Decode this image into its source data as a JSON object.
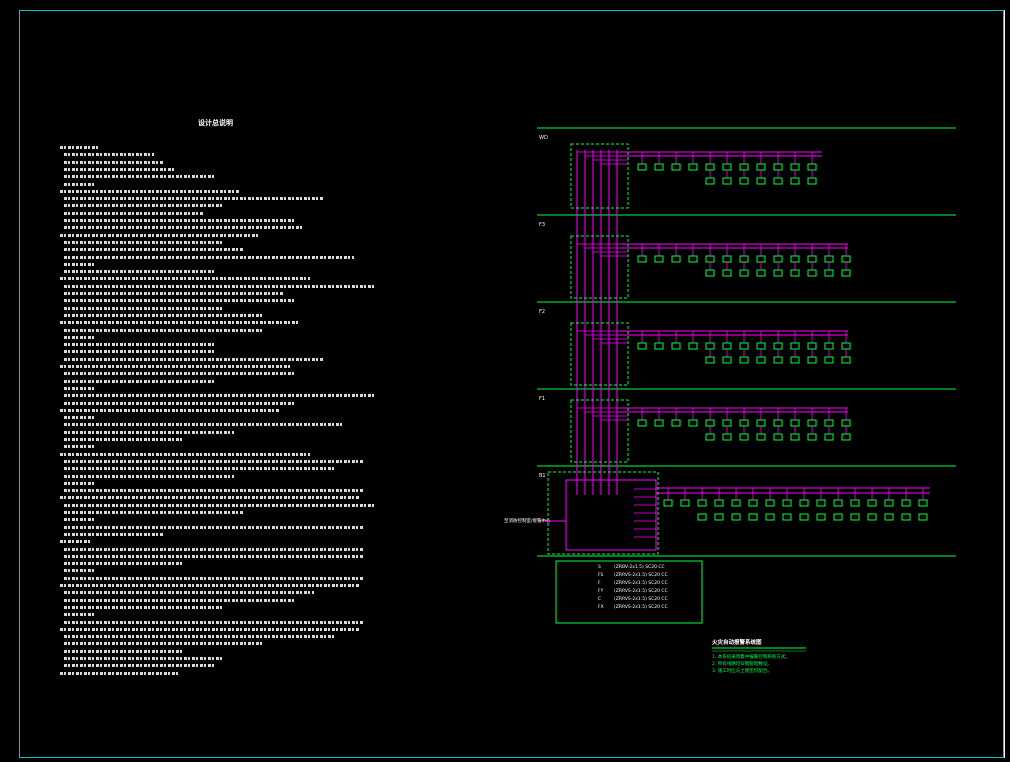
{
  "drawing": {
    "notes_title": "设计总说明",
    "diagram_title": "火灾自动报警系统图",
    "floors": [
      "WD",
      "F3",
      "F2",
      "F1",
      "B1"
    ],
    "legend": {
      "rows": [
        {
          "code": "S",
          "cable": "(ZRBV-2x1.5)  SC20 CC"
        },
        {
          "code": "FS",
          "cable": "(ZRRVS-2x1.5) SC20 CC"
        },
        {
          "code": "F",
          "cable": "(ZRRVS-2x1.5) SC20 CC"
        },
        {
          "code": "FY",
          "cable": "(ZRRVS-2x1.5) SC20 CC"
        },
        {
          "code": "C",
          "cable": "(ZRRVS-2x1.5) SC20 CC"
        },
        {
          "code": "FX",
          "cable": "(ZRRVS-2x1.5) SC20 CC"
        }
      ]
    },
    "external_label": "至消防控制室/接警中心",
    "diagram_notes": [
      "1. 本系统采用集中报警控制系统方式。",
      "2. 所有线路均穿钢管暗敷设。",
      "3. 施工时应与土建密切配合。"
    ]
  },
  "colors": {
    "frame": "#00c8d8",
    "magenta": "#ff00ff",
    "green": "#00ff3c",
    "white": "#ffffff"
  }
}
